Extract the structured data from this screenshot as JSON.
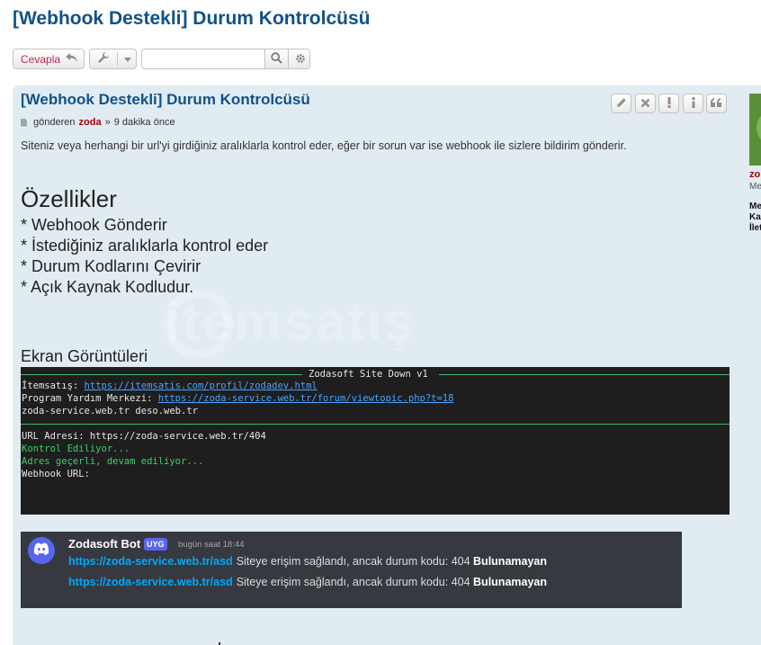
{
  "topic": {
    "title": "[Webhook Destekli] Durum Kontrolcüsü"
  },
  "action_bar": {
    "reply_label": "Cevapla",
    "search_placeholder": "",
    "search_value": ""
  },
  "post": {
    "title": "[Webhook Destekli] Durum Kontrolcüsü",
    "author_prefix": "gönderen",
    "author": "zoda",
    "author_sep": "»",
    "time": "9 dakika önce",
    "description": "Siteniz veya herhangi bir url'yi girdiğiniz aralıklarla kontrol eder, eğer bir sorun var ise webhook ile sizlere bildirim gönderir.",
    "features_heading": "Özellikler",
    "features": [
      "* Webhook Gönderir",
      "* İstediğiniz aralıklarla kontrol eder",
      "* Durum Kodlarını Çevirir",
      "* Açık Kaynak Kodludur."
    ],
    "screenshots_heading": "Ekran Görüntüleri",
    "watermark": "itemsatış"
  },
  "terminal": {
    "title": "Zodasoft Site Down v1",
    "line1_label": "İtemsatış: ",
    "line1_link": "https://itemsatis.com/profil/zodadev.html",
    "line2_label": "Program Yardım Merkezi: ",
    "line2_link": "https://zoda-service.web.tr/forum/viewtopic.php?t=18",
    "line3": "zoda-service.web.tr   deso.web.tr",
    "line4": "URL Adresi: https://zoda-service.web.tr/404",
    "line5": "Kontrol Ediliyor...",
    "line6": "Adres geçerli, devam ediliyor...",
    "line7": "Webhook URL:"
  },
  "discord": {
    "bot_name": "Zodasoft Bot",
    "bot_tag": "UYG",
    "time": "bugün saat 18:44",
    "messages": [
      {
        "link": "https://zoda-service.web.tr/asd",
        "text": "Siteye erişim sağlandı, ancak durum kodu: 404 ",
        "bold": "Bulunamayan"
      },
      {
        "link": "https://zoda-service.web.tr/asd",
        "text": "Siteye erişim sağlandı, ancak durum kodu: 404 ",
        "bold": "Bulunamayan"
      }
    ]
  },
  "sidebar": {
    "name_fragment": "zo",
    "rank_fragment": "Me",
    "line1": "Me",
    "line2": "Ka",
    "line3": "İlet"
  },
  "colors": {
    "title_blue": "#105289",
    "post_bg": "#e1ebf2",
    "reply_red": "#bc2a4d",
    "author_red": "#aa0000",
    "terminal_bg": "#1e1e1e",
    "discord_bg": "#36393f"
  },
  "icons": {
    "reply": "reply-arrow-icon",
    "tools": "wrench-icon",
    "search": "search-icon",
    "advanced_search": "gear-icon",
    "edit": "pencil-icon",
    "delete": "close-icon",
    "report": "exclamation-icon",
    "info": "info-icon",
    "quote": "quote-icon"
  }
}
